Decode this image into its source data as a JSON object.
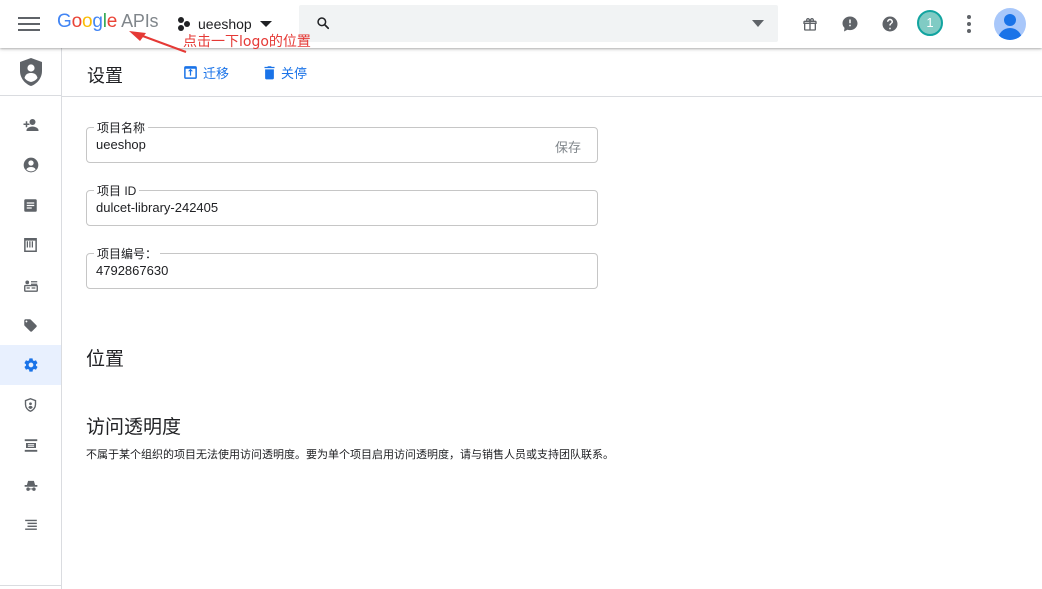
{
  "topbar": {
    "logo_google": [
      "G",
      "o",
      "o",
      "g",
      "l",
      "e"
    ],
    "logo_apis": "APIs",
    "project_name": "ueeshop",
    "search_placeholder": "",
    "notification_count": "1"
  },
  "annotation": {
    "text": "点击一下logo的位置",
    "color": "#e53935"
  },
  "sidebar": {
    "items": [
      {
        "name": "iam",
        "icon": "person-add-icon"
      },
      {
        "name": "identity",
        "icon": "account-circle-icon"
      },
      {
        "name": "policy",
        "icon": "article-icon"
      },
      {
        "name": "audit-logs",
        "icon": "receipt-icon"
      },
      {
        "name": "service-accounts",
        "icon": "card-account-icon"
      },
      {
        "name": "labels",
        "icon": "label-tag-icon"
      },
      {
        "name": "settings",
        "icon": "gear-icon",
        "active": true
      },
      {
        "name": "privacy",
        "icon": "shield-icon"
      },
      {
        "name": "crypto-keys",
        "icon": "list-box-icon"
      },
      {
        "name": "identity-aware-proxy",
        "icon": "incognito-icon"
      },
      {
        "name": "roles",
        "icon": "list-icon"
      }
    ]
  },
  "main": {
    "title": "设置",
    "migrate_label": "迁移",
    "shutdown_label": "关停",
    "fields": {
      "project_name": {
        "label": "项目名称",
        "value": "ueeshop",
        "save": "保存"
      },
      "project_id": {
        "label": "项目 ID",
        "value": "dulcet-library-242405"
      },
      "project_number": {
        "label": "项目编号：",
        "value": "4792867630"
      }
    },
    "location_title": "位置",
    "access_title": "访问透明度",
    "access_desc": "不属于某个组织的项目无法使用访问透明度。要为单个项目启用访问透明度，请与销售人员或支持团队联系。"
  },
  "colors": {
    "accent": "#1a73e8",
    "active_bg": "#e8f0fe",
    "icon_grey": "#5f6368"
  }
}
